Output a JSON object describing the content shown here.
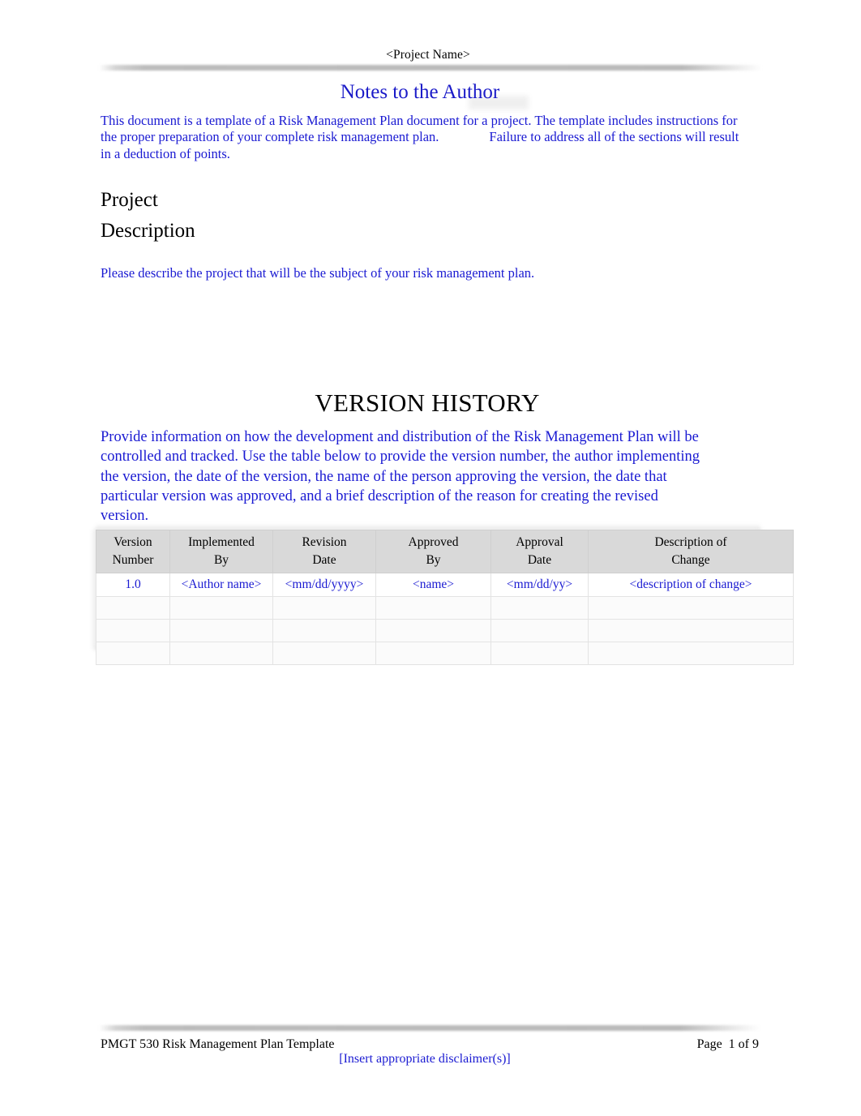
{
  "document": {
    "header": {
      "project_name": "<Project Name>"
    },
    "notes": {
      "heading": "Notes to the Author",
      "paragraph_part1": "This document is a template of a Risk Management Plan document for a project. The template includes instructions for the proper preparation of your complete risk management plan.",
      "paragraph_part2": "Failure to address all of the sections will result in a deduction of points."
    },
    "project_description": {
      "heading_line1": "Project",
      "heading_line2": "Description",
      "paragraph": "Please describe the project that will be the subject of your risk management plan."
    },
    "version_history": {
      "heading": "VERSION HISTORY",
      "paragraph": "Provide information on how the development and distribution of the Risk Management Plan will be controlled and tracked. Use the table below to provide the version number, the author implementing the version, the date of the version, the name of the person approving the version, the date that particular version was approved, and a brief description of the reason for creating the revised version.",
      "table": {
        "headers": [
          {
            "line1": "Version",
            "line2": "Number"
          },
          {
            "line1": "Implemented",
            "line2": "By"
          },
          {
            "line1": "Revision",
            "line2": "Date"
          },
          {
            "line1": "Approved",
            "line2": "By"
          },
          {
            "line1": "Approval",
            "line2": "Date"
          },
          {
            "line1": "Description of",
            "line2": "Change"
          }
        ],
        "rows": [
          {
            "version_number": "1.0",
            "implemented_by": "<Author name>",
            "revision_date": "<mm/dd/yyyy>",
            "approved_by": "<name>",
            "approval_date": "<mm/dd/yy>",
            "description_of_change": "<description of change>"
          },
          {
            "version_number": "",
            "implemented_by": "",
            "revision_date": "",
            "approved_by": "",
            "approval_date": "",
            "description_of_change": ""
          },
          {
            "version_number": "",
            "implemented_by": "",
            "revision_date": "",
            "approved_by": "",
            "approval_date": "",
            "description_of_change": ""
          },
          {
            "version_number": "",
            "implemented_by": "",
            "revision_date": "",
            "approved_by": "",
            "approval_date": "",
            "description_of_change": ""
          }
        ]
      }
    },
    "footer": {
      "left": "PMGT 530 Risk Management Plan Template",
      "right": "Page  1 of 9",
      "disclaimer": "[Insert appropriate disclaimer(s)]"
    },
    "colors": {
      "instruction_blue": "#1a1ad2",
      "heading_black": "#000000",
      "table_header_gray": "#d9d9d9"
    }
  }
}
